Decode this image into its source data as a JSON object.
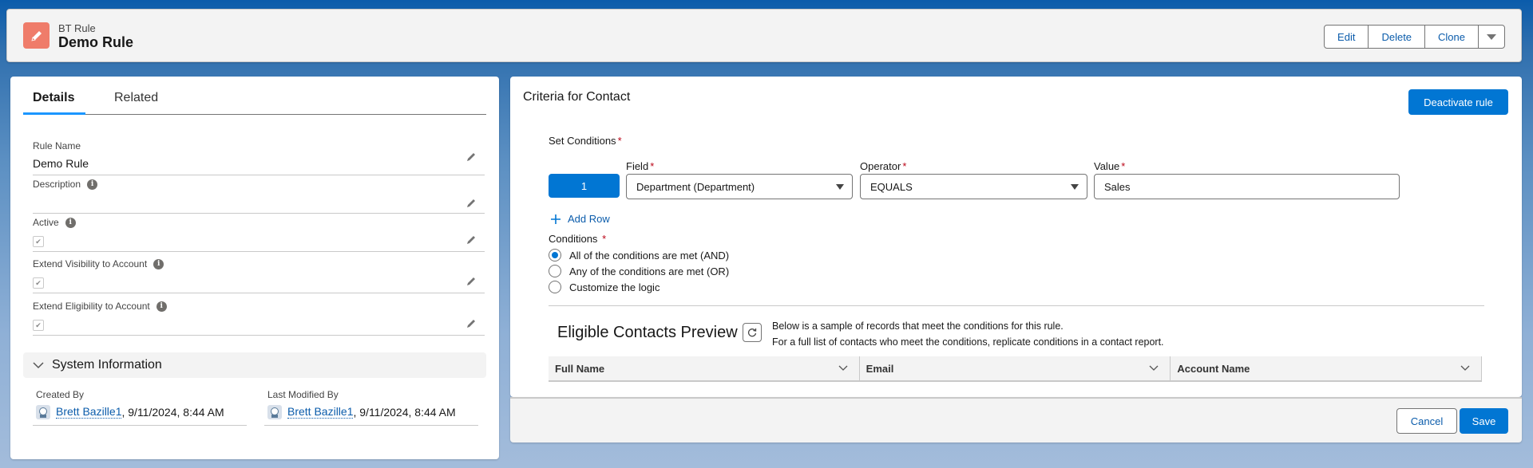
{
  "header": {
    "object_type": "BT Rule",
    "title": "Demo Rule",
    "icon": "pencil-icon",
    "icon_color": "#ef7c6a",
    "actions": [
      "Edit",
      "Delete",
      "Clone"
    ]
  },
  "details": {
    "tabs": [
      "Details",
      "Related"
    ],
    "active_tab": "Details",
    "fields": [
      {
        "label": "Rule Name",
        "value": "Demo Rule",
        "info": false
      },
      {
        "label": "Description",
        "value": "",
        "info": true
      },
      {
        "label": "Active",
        "checked": true,
        "info": true
      },
      {
        "label": "Extend Visibility to Account",
        "checked": true,
        "info": true
      },
      {
        "label": "Extend Eligibility to Account",
        "checked": true,
        "info": true
      }
    ],
    "system_section": "System Information",
    "created_by": {
      "label": "Created By",
      "user": "Brett Bazille1",
      "timestamp": ", 9/11/2024, 8:44 AM"
    },
    "last_modified_by": {
      "label": "Last Modified By",
      "user": "Brett Bazille1",
      "timestamp": ", 9/11/2024, 8:44 AM"
    }
  },
  "criteria": {
    "title": "Criteria for Contact",
    "deactivate_label": "Deactivate rule",
    "set_conditions_label": "Set Conditions",
    "row_number": "1",
    "field_label": "Field",
    "field_value": "Department (Department)",
    "operator_label": "Operator",
    "operator_value": "EQUALS",
    "value_label": "Value",
    "value_value": "Sales",
    "add_row_label": "Add Row",
    "conditions_label": "Conditions",
    "condition_options": [
      {
        "label": "All of the conditions are met (AND)",
        "selected": true
      },
      {
        "label": "Any of the conditions are met (OR)",
        "selected": false
      },
      {
        "label": "Customize the logic",
        "selected": false
      }
    ],
    "preview_title": "Eligible Contacts Preview",
    "preview_desc_1": "Below is a sample of records that meet the conditions for this rule.",
    "preview_desc_2": "For a full list of contacts who meet the conditions, replicate conditions in a contact report.",
    "columns": [
      "Full Name",
      "Email",
      "Account Name"
    ]
  },
  "footer": {
    "cancel_label": "Cancel",
    "save_label": "Save"
  },
  "colors": {
    "brand": "#0176d3",
    "link": "#0b5cab",
    "required": "#ba0517"
  }
}
